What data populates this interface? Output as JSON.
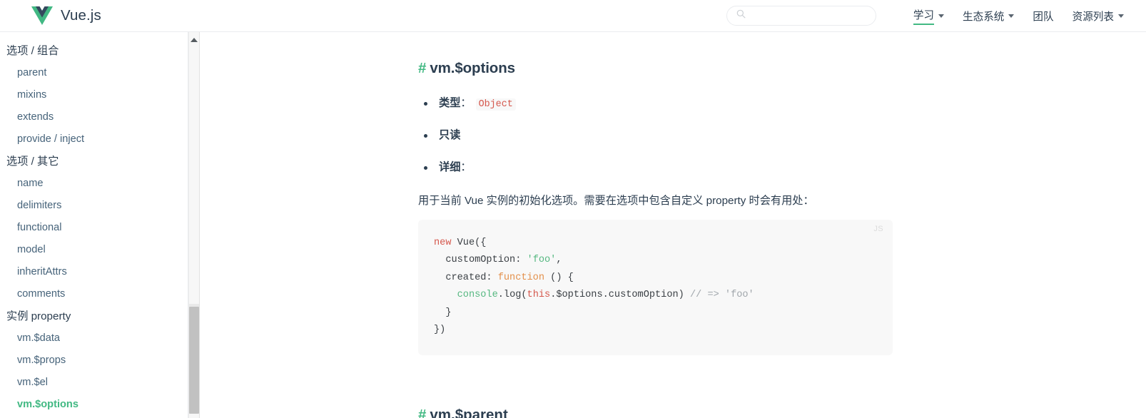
{
  "header": {
    "brand": {
      "text": "Vue.js",
      "logo_icon": "vue-logo-icon"
    },
    "search": {
      "placeholder": "",
      "value": "",
      "icon": "search-icon"
    },
    "nav": [
      {
        "label": "学习",
        "has_dropdown": true,
        "active": true
      },
      {
        "label": "生态系统",
        "has_dropdown": true,
        "active": false
      },
      {
        "label": "团队",
        "has_dropdown": false,
        "active": false
      },
      {
        "label": "资源列表",
        "has_dropdown": true,
        "active": false
      }
    ]
  },
  "sidebar": {
    "groups": [
      {
        "title": "选项 / 组合",
        "items": [
          {
            "label": "parent",
            "active": false
          },
          {
            "label": "mixins",
            "active": false
          },
          {
            "label": "extends",
            "active": false
          },
          {
            "label": "provide / inject",
            "active": false
          }
        ]
      },
      {
        "title": "选项 / 其它",
        "items": [
          {
            "label": "name",
            "active": false
          },
          {
            "label": "delimiters",
            "active": false
          },
          {
            "label": "functional",
            "active": false
          },
          {
            "label": "model",
            "active": false
          },
          {
            "label": "inheritAttrs",
            "active": false
          },
          {
            "label": "comments",
            "active": false
          }
        ]
      },
      {
        "title": "实例 property",
        "items": [
          {
            "label": "vm.$data",
            "active": false
          },
          {
            "label": "vm.$props",
            "active": false
          },
          {
            "label": "vm.$el",
            "active": false
          },
          {
            "label": "vm.$options",
            "active": true
          }
        ]
      }
    ]
  },
  "main": {
    "heading": {
      "anchor": "#",
      "title": "vm.$options"
    },
    "bullets": [
      {
        "label": "类型",
        "separator": "：",
        "code": "Object"
      },
      {
        "label": "只读",
        "separator": "",
        "code": ""
      },
      {
        "label": "详细",
        "separator": "：",
        "code": ""
      }
    ],
    "detail_paragraph": "用于当前 Vue 实例的初始化选项。需要在选项中包含自定义 property 时会有用处：",
    "code_block": {
      "lang_badge": "JS",
      "lines": [
        {
          "tokens": [
            {
              "t": "new",
              "c": "tk-kw"
            },
            {
              "t": " Vue({",
              "c": ""
            }
          ]
        },
        {
          "tokens": [
            {
              "t": "  customOption: ",
              "c": ""
            },
            {
              "t": "'foo'",
              "c": "tk-str"
            },
            {
              "t": ",",
              "c": ""
            }
          ]
        },
        {
          "tokens": [
            {
              "t": "  created: ",
              "c": ""
            },
            {
              "t": "function",
              "c": "tk-fn"
            },
            {
              "t": " () {",
              "c": ""
            }
          ]
        },
        {
          "tokens": [
            {
              "t": "    ",
              "c": ""
            },
            {
              "t": "console",
              "c": "tk-builtin"
            },
            {
              "t": ".log(",
              "c": ""
            },
            {
              "t": "this",
              "c": "tk-this"
            },
            {
              "t": ".$options.customOption) ",
              "c": ""
            },
            {
              "t": "// => 'foo'",
              "c": "tk-com"
            }
          ]
        },
        {
          "tokens": [
            {
              "t": "  }",
              "c": ""
            }
          ]
        },
        {
          "tokens": [
            {
              "t": "})",
              "c": ""
            }
          ]
        }
      ]
    },
    "next_heading": {
      "anchor": "#",
      "title": "vm.$parent"
    }
  },
  "colors": {
    "brand_green": "#42b983",
    "text_dark": "#2c3e50",
    "code_bg": "#f8f8f8",
    "border": "#eaecef",
    "inline_code": "#d5584d"
  }
}
